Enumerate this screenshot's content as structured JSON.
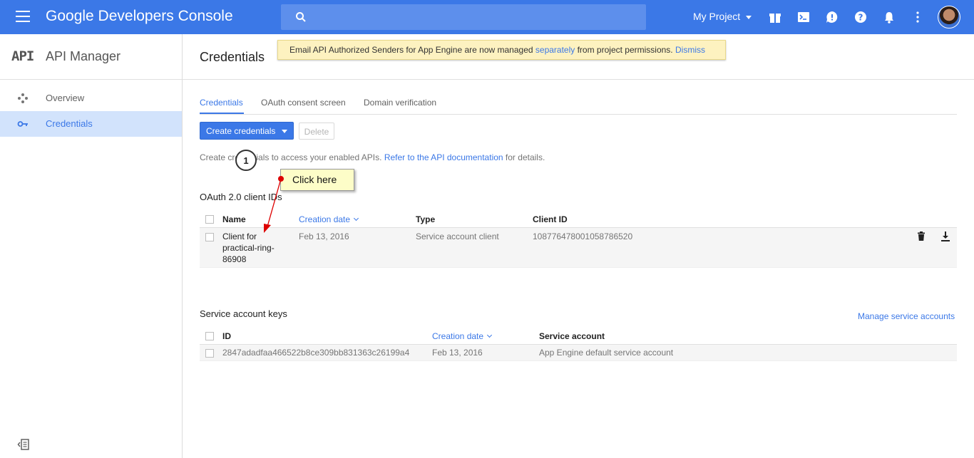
{
  "topbar": {
    "brand": "Google Developers Console",
    "search_placeholder": "",
    "project": "My Project",
    "color": "#3b78e7"
  },
  "sidebar": {
    "logo": "API",
    "title": "API Manager",
    "items": [
      {
        "label": "Overview",
        "icon": "overview-icon"
      },
      {
        "label": "Credentials",
        "icon": "key-icon",
        "active": true
      }
    ]
  },
  "main": {
    "title": "Credentials",
    "notice": {
      "text_before": "Email API Authorized Senders for App Engine are now managed ",
      "link": "separately",
      "text_after": " from project permissions. ",
      "dismiss": "Dismiss"
    },
    "tabs": [
      "Credentials",
      "OAuth consent screen",
      "Domain verification"
    ],
    "create_button": "Create credentials",
    "delete_button": "Delete",
    "description": {
      "before": "Create credentials to access your enabled APIs. ",
      "link": "Refer to the API documentation",
      "after": " for details."
    },
    "oauth": {
      "title": "OAuth 2.0 client IDs",
      "columns": [
        "Name",
        "Creation date",
        "Type",
        "Client ID"
      ],
      "rows": [
        {
          "name": "Client for practical-ring-86908",
          "date": "Feb 13, 2016",
          "type": "Service account client",
          "client_id": "108776478001058786520"
        }
      ]
    },
    "service_keys": {
      "title": "Service account keys",
      "manage_link": "Manage service accounts",
      "columns": [
        "ID",
        "Creation date",
        "Service account"
      ],
      "rows": [
        {
          "id": "2847adadfaa466522b8ce309bb831363c26199a4",
          "date": "Feb 13, 2016",
          "account": "App Engine default service account"
        }
      ]
    }
  },
  "annotation": {
    "step": "1",
    "callout": "Click here"
  }
}
